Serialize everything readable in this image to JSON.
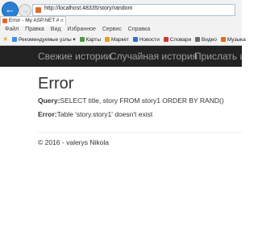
{
  "browser": {
    "url": "http://localhost:48335/story/random",
    "tab_title": "Error - My ASP.NET Applica...",
    "tab_close": "×",
    "back_icon": "arrow-left-icon",
    "forward_icon": "arrow-right-icon",
    "menu": [
      "Файл",
      "Правка",
      "Вид",
      "Избранное",
      "Сервис",
      "Справка"
    ],
    "favorites": [
      {
        "label": "Рекомендуемые узлы ▾",
        "color": "#3a8ee6"
      },
      {
        "label": "Карты",
        "color": "#4a9e3a"
      },
      {
        "label": "Маркет",
        "color": "#e0a21c"
      },
      {
        "label": "Новости",
        "color": "#2f6fc9"
      },
      {
        "label": "Словари",
        "color": "#d2382c"
      },
      {
        "label": "Видео",
        "color": "#6a6a6a"
      },
      {
        "label": "Музыка",
        "color": "#e06a1c"
      }
    ]
  },
  "navbar": {
    "items": [
      "Свежие истории",
      "Случайная история",
      "Прислать ис"
    ]
  },
  "content": {
    "title": "Error",
    "query_label": "Query:",
    "query_value": "SELECT title, story FROM story1 ORDER BY RAND()",
    "error_label": "Error:",
    "error_value": "Table 'story.story1' doesn't exist",
    "footer": "© 2016 - valerys Nikola"
  },
  "colors": {
    "navbar_bg": "#222222",
    "navbar_text": "#9d9d9d",
    "body_text": "#333333"
  }
}
